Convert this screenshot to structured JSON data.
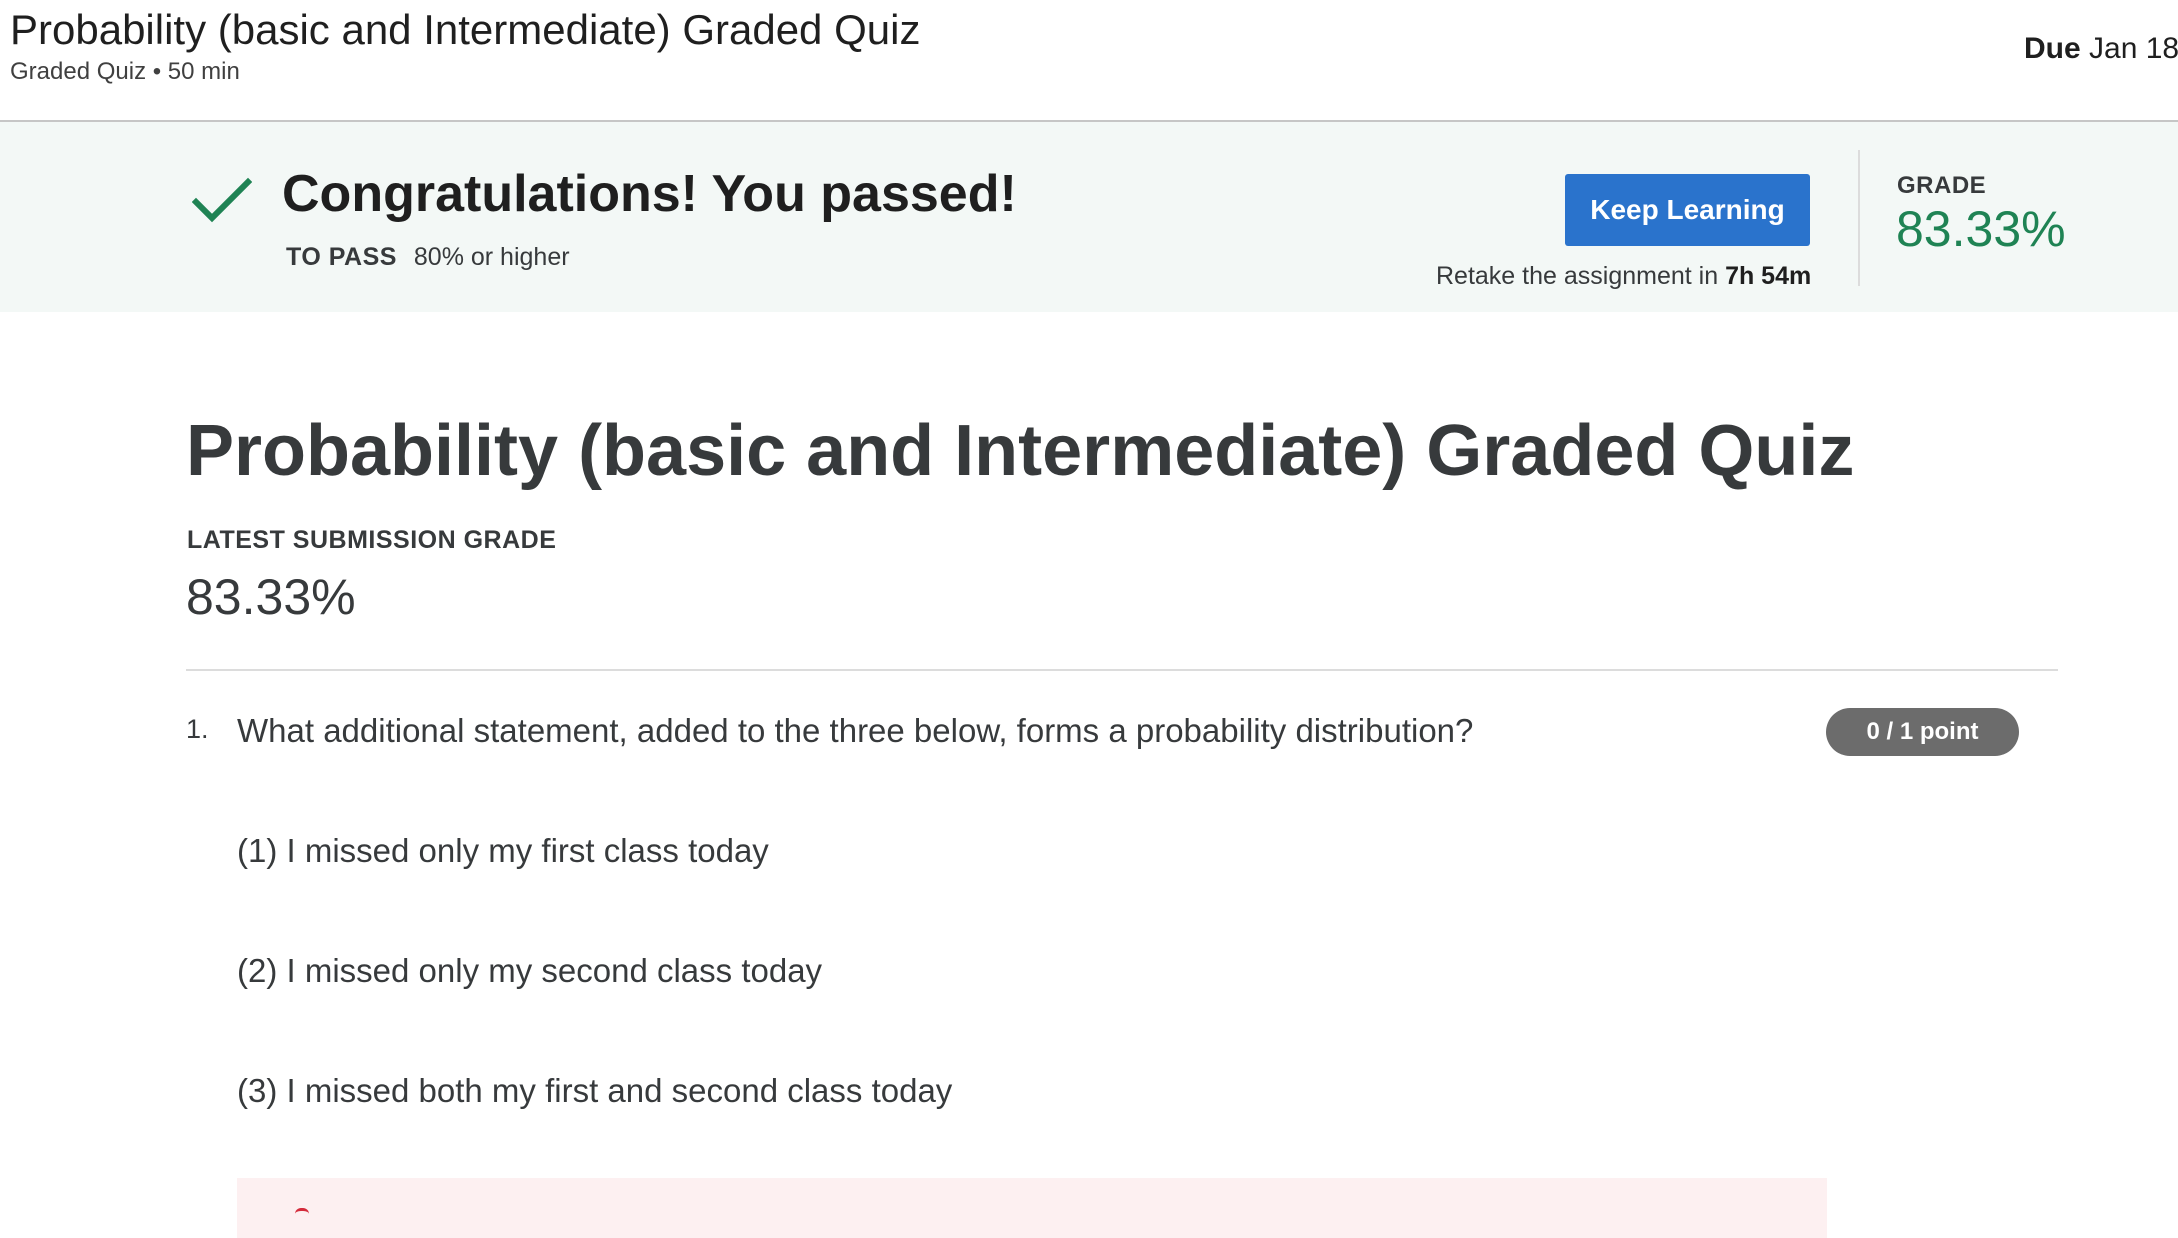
{
  "header": {
    "title": "Probability (basic and Intermediate) Graded Quiz",
    "meta": "Graded Quiz • 50 min",
    "due_label": "Due",
    "due_value": "Jan 18,"
  },
  "banner": {
    "message": "Congratulations! You passed!",
    "to_pass_label": "TO PASS",
    "to_pass_value": "80% or higher",
    "keep_learning_label": "Keep Learning",
    "retake_text": "Retake the assignment in",
    "retake_time": "7h 54m",
    "grade_label": "GRADE",
    "grade_value": "83.33%",
    "colors": {
      "success": "#1f8354",
      "button": "#2a73cc",
      "background": "#f3f8f6"
    }
  },
  "main": {
    "title": "Probability (basic and Intermediate) Graded Quiz",
    "latest_label": "LATEST SUBMISSION GRADE",
    "latest_value": "83.33%"
  },
  "question": {
    "number": "1.",
    "text": "What additional statement, added to the three below, forms a probability distribution?",
    "points": "0 / 1 point",
    "statements": [
      "(1) I missed only my first class today",
      "(2) I missed only my second class today",
      "(3) I missed both my first and second class today"
    ],
    "feedback_color": "#fdf0f1"
  },
  "icons": {
    "pass": "checkmark-icon"
  }
}
